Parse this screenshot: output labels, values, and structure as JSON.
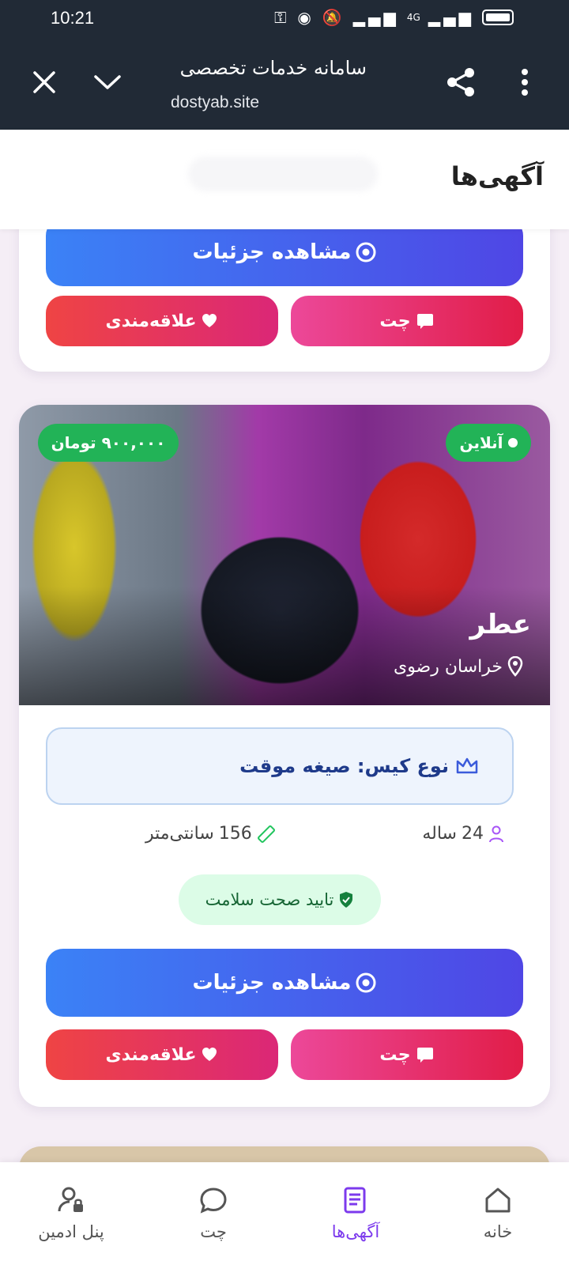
{
  "status_bar": {
    "time": "10:21",
    "network": "4G"
  },
  "browser": {
    "title": "سامانه خدمات تخصصی",
    "url": "dostyab.site"
  },
  "header": {
    "title": "آگهی‌ها"
  },
  "buttons": {
    "details": "مشاهده جزئیات",
    "chat": "چت",
    "favorite": "علاقه‌مندی"
  },
  "ad": {
    "price": "۹۰۰,۰۰۰ تومان",
    "status": "آنلاین",
    "name": "عطر",
    "location": "خراسان رضوی",
    "case_type": "نوع کیس: صیغه موقت",
    "age_value": "24",
    "age_unit": "ساله",
    "height_value": "156",
    "height_unit": "سانتی‌متر",
    "health": "تایید صحت سلامت"
  },
  "nav": [
    {
      "label": "خانه",
      "icon": "home-icon"
    },
    {
      "label": "آگهی‌ها",
      "icon": "ads-icon"
    },
    {
      "label": "چت",
      "icon": "chat-icon"
    },
    {
      "label": "پنل ادمین",
      "icon": "admin-icon"
    }
  ],
  "colors": {
    "accent": "#7c3aed",
    "chrome": "#212a36",
    "badge_green": "#22b357"
  }
}
